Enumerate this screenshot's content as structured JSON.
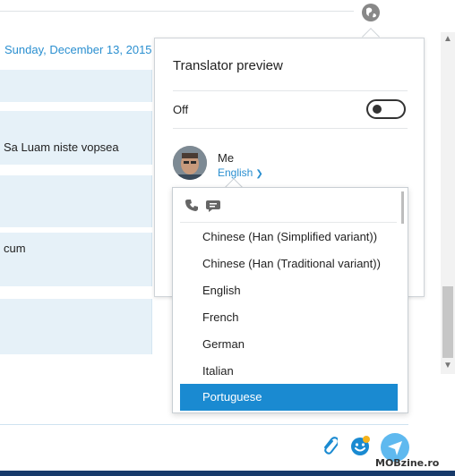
{
  "conversation": {
    "date": "Sunday, December 13, 2015",
    "messages": [
      {
        "text": ""
      },
      {
        "text": "Sa Luam niste vopsea"
      },
      {
        "text": ""
      },
      {
        "text": "cum"
      },
      {
        "text": ""
      }
    ]
  },
  "translator_panel": {
    "title": "Translator preview",
    "toggle_label": "Off",
    "toggle_state": "off",
    "participant": {
      "name": "Me",
      "language": "English"
    }
  },
  "language_dropdown": {
    "icons": [
      "phone-icon",
      "chat-bubble-icon"
    ],
    "items": [
      {
        "label": "Chinese (Han (Simplified variant))"
      },
      {
        "label": "Chinese (Han (Traditional variant))"
      },
      {
        "label": "English"
      },
      {
        "label": "French"
      },
      {
        "label": "German"
      },
      {
        "label": "Italian"
      },
      {
        "label": "Portuguese"
      }
    ],
    "selected": "Portuguese"
  },
  "composer": {
    "icons": [
      "paperclip-icon",
      "emoticon-icon",
      "send-icon"
    ]
  },
  "watermark": "MOBzine.ro",
  "colors": {
    "accent": "#1a8ad1",
    "link": "#2a8fd0",
    "bubble": "#e6f1f8",
    "send": "#5fb9ef"
  }
}
